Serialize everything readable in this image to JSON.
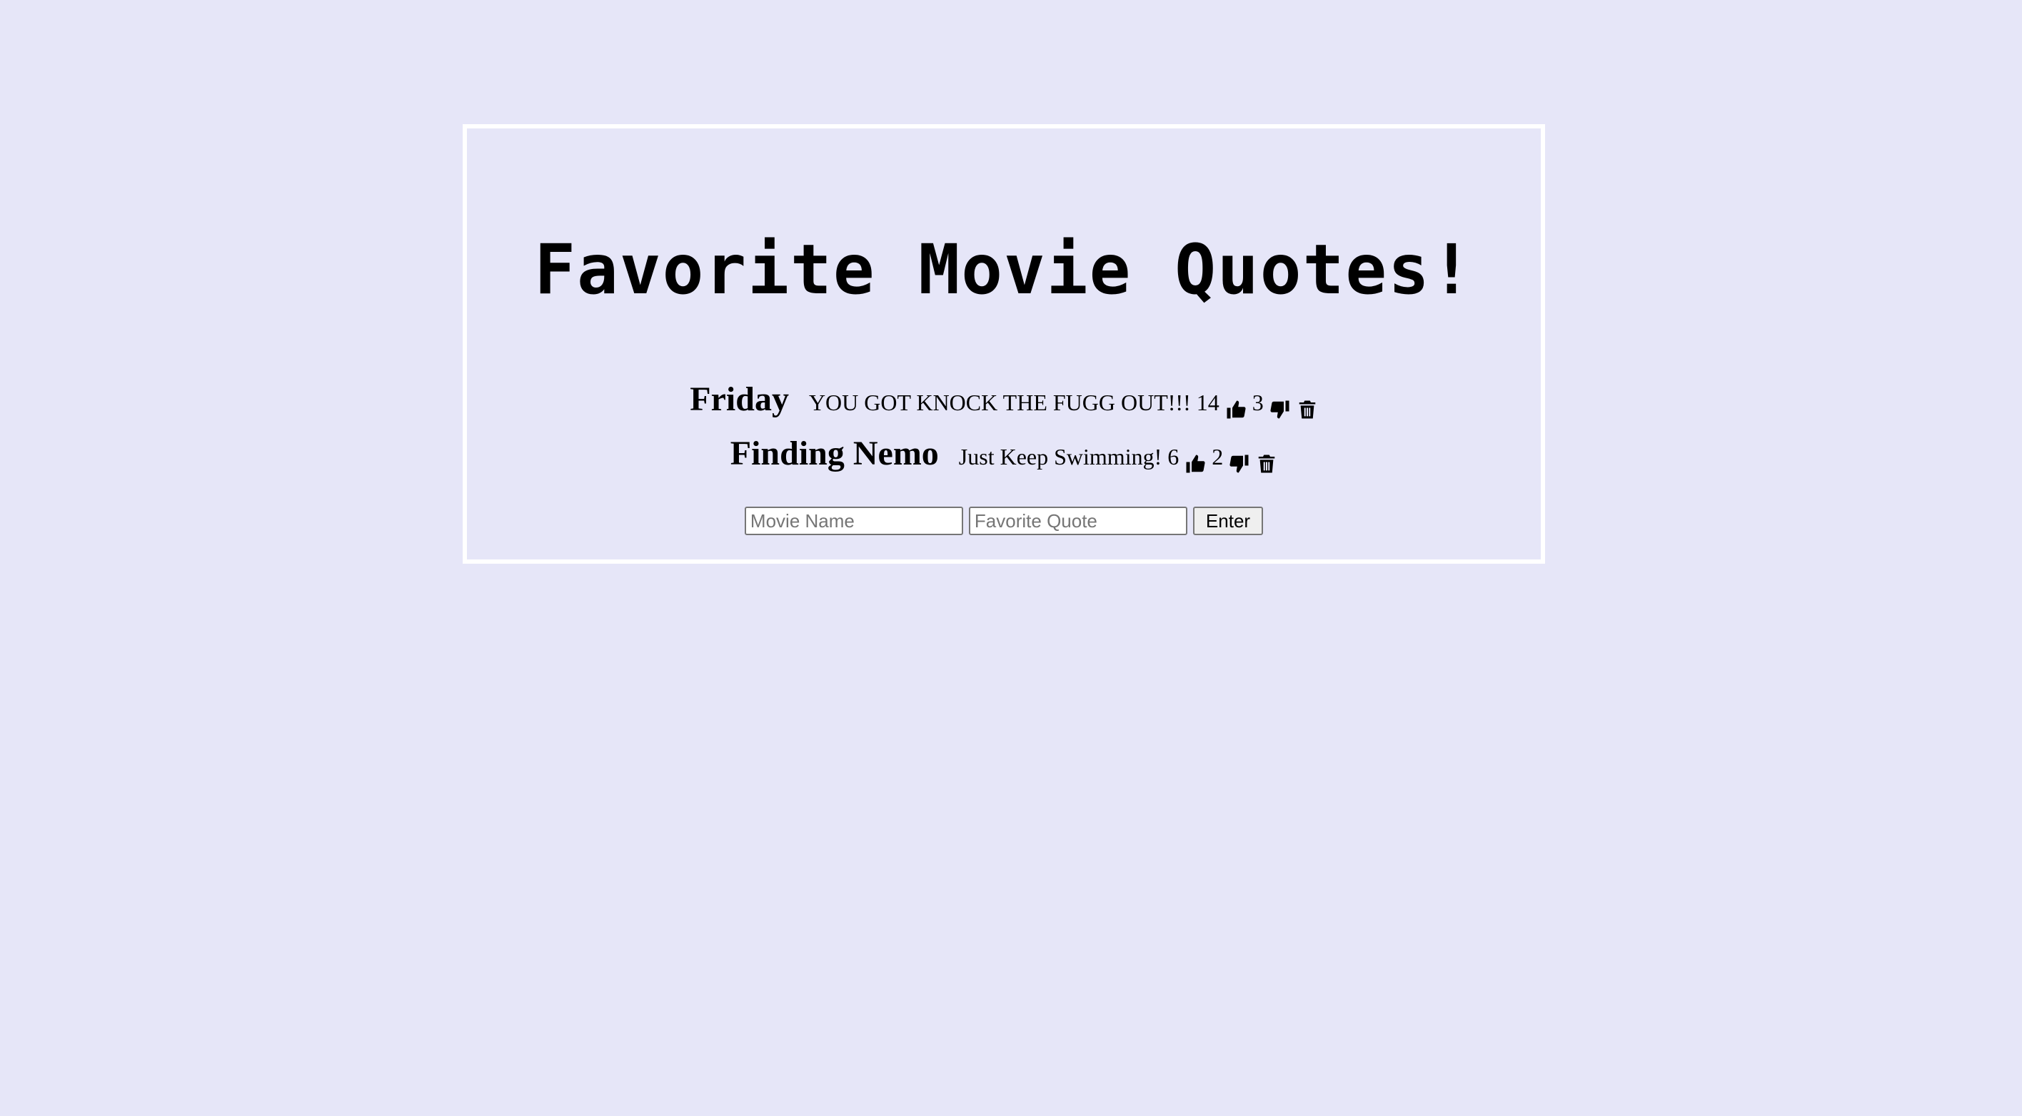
{
  "page": {
    "title": "Favorite Movie Quotes!"
  },
  "quotes": [
    {
      "movie": "Friday",
      "quote": "YOU GOT KNOCK THE FUGG OUT!!!",
      "thumbs_up": "14",
      "thumbs_down": "3"
    },
    {
      "movie": "Finding Nemo",
      "quote": "Just Keep Swimming!",
      "thumbs_up": "6",
      "thumbs_down": "2"
    }
  ],
  "form": {
    "movie_placeholder": "Movie Name",
    "quote_placeholder": "Favorite Quote",
    "submit_label": "Enter"
  },
  "icons": {
    "upvote": "thumbs-up-icon",
    "downvote": "thumbs-down-icon",
    "delete": "trash-icon"
  },
  "colors": {
    "background": "#e6e6f8",
    "panel_border": "#ffffff",
    "text": "#000000"
  }
}
